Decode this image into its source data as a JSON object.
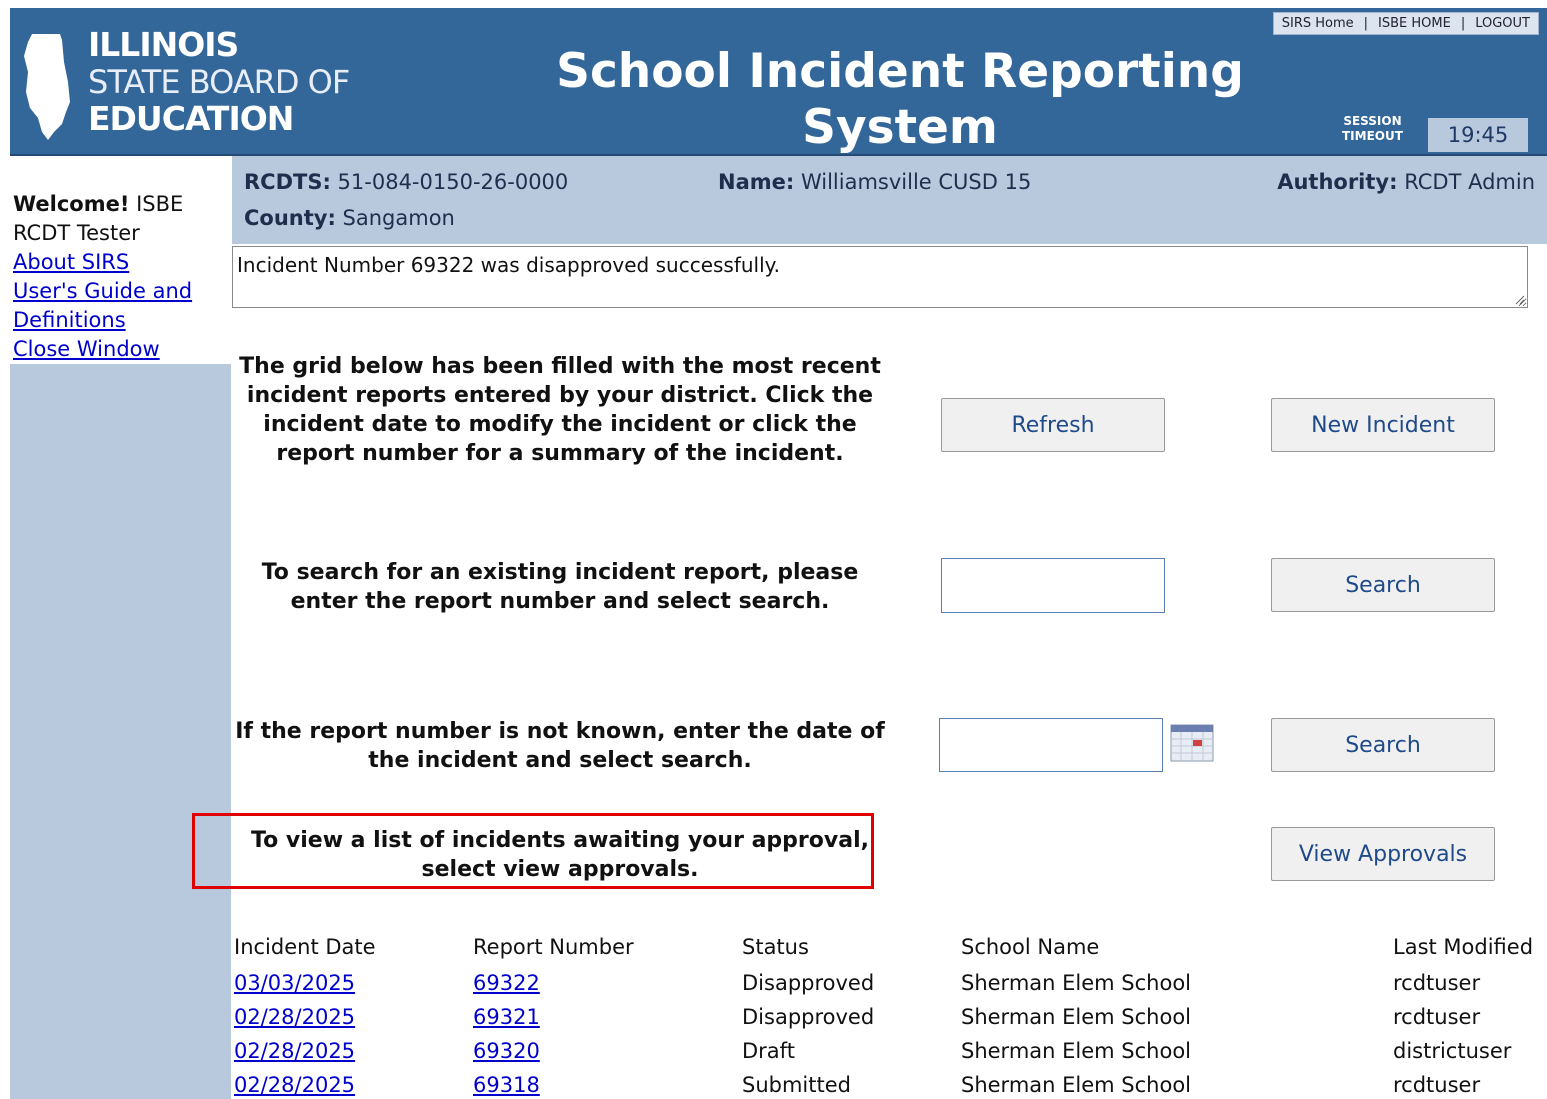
{
  "header": {
    "logo": {
      "line1": "ILLINOIS",
      "line2": "STATE BOARD OF",
      "line3": "EDUCATION"
    },
    "title": "School Incident Reporting System",
    "links": [
      "SIRS Home",
      "ISBE HOME",
      "LOGOUT"
    ],
    "session_label_1": "SESSION",
    "session_label_2": "TIMEOUT",
    "session_timer": "19:45"
  },
  "sidebar": {
    "welcome_bold": "Welcome!",
    "welcome_rest": " ISBE RCDT Tester",
    "links": [
      "About SIRS",
      "User's Guide and Definitions",
      "Close Window"
    ]
  },
  "info": {
    "rcdts_label": "RCDTS:",
    "rcdts_value": " 51-084-0150-26-0000",
    "name_label": "Name:",
    "name_value": " Williamsville CUSD 15",
    "authority_label": "Authority:",
    "authority_value": " RCDT Admin",
    "county_label": "County:",
    "county_value": " Sangamon"
  },
  "message": "Incident Number 69322 was disapproved successfully.",
  "instructions": {
    "grid_info": "The grid below has been filled with the most recent incident reports entered by your district. Click the incident date to modify the incident or click the report number for a summary of the incident.",
    "search_number": "To search for an existing incident report, please enter the report number and select search.",
    "search_date": "If the report number is not known, enter the date of the incident and select search.",
    "approvals": "To view a list of incidents awaiting your approval, select view approvals."
  },
  "buttons": {
    "refresh": "Refresh",
    "new_incident": "New Incident",
    "search_number": "Search",
    "search_date": "Search",
    "view_approvals": "View Approvals"
  },
  "inputs": {
    "report_number": "",
    "incident_date": ""
  },
  "grid": {
    "headers": [
      "Incident Date",
      "Report Number",
      "Status",
      "School Name",
      "Last Modified"
    ],
    "rows": [
      [
        "03/03/2025",
        "69322",
        "Disapproved",
        "Sherman Elem School",
        "rcdtuser"
      ],
      [
        "02/28/2025",
        "69321",
        "Disapproved",
        "Sherman Elem School",
        "rcdtuser"
      ],
      [
        "02/28/2025",
        "69320",
        "Draft",
        "Sherman Elem School",
        "districtuser"
      ],
      [
        "02/28/2025",
        "69318",
        "Submitted",
        "Sherman Elem School",
        "rcdtuser"
      ]
    ]
  },
  "colors": {
    "header_bg": "#336699",
    "sidebar_bg": "#b8c9dd",
    "link": "#0000cc",
    "highlight_box": "#e00000"
  }
}
